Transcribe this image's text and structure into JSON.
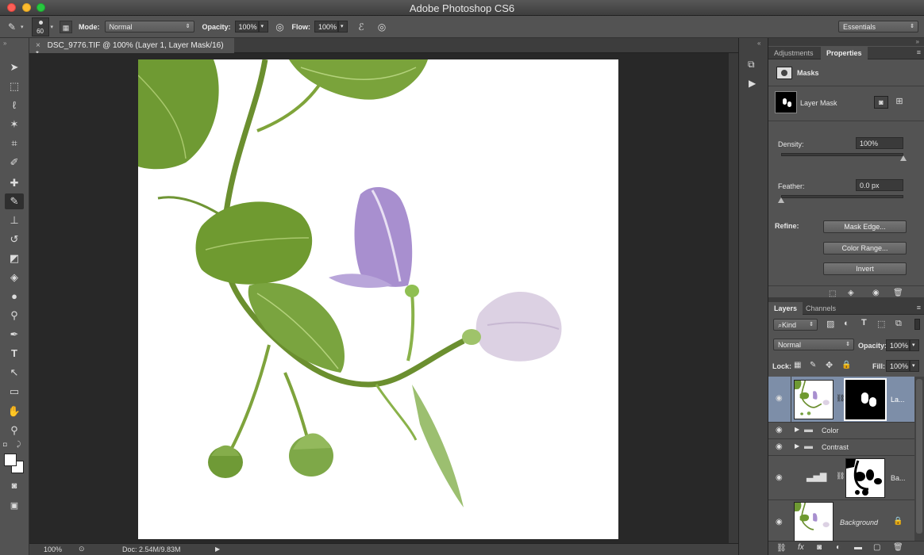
{
  "window": {
    "title": "Adobe Photoshop CS6"
  },
  "options": {
    "brush_size": "60",
    "mode_label": "Mode:",
    "mode_value": "Normal",
    "opacity_label": "Opacity:",
    "opacity_value": "100%",
    "flow_label": "Flow:",
    "flow_value": "100%",
    "workspace": "Essentials"
  },
  "document": {
    "tab_title": "DSC_9776.TIF @ 100% (Layer 1, Layer Mask/16) *",
    "close_glyph": "×"
  },
  "status": {
    "zoom": "100%",
    "doc_info": "Doc: 2.54M/9.83M"
  },
  "properties": {
    "tabs": [
      "Adjustments",
      "Properties"
    ],
    "section": "Masks",
    "mask_name": "Layer Mask",
    "density_label": "Density:",
    "density_value": "100%",
    "density_fraction": 1.0,
    "feather_label": "Feather:",
    "feather_value": "0.0 px",
    "feather_fraction": 0.0,
    "refine_label": "Refine:",
    "buttons": [
      "Mask Edge...",
      "Color Range...",
      "Invert"
    ]
  },
  "layers": {
    "tabs": [
      "Layers",
      "Channels"
    ],
    "filter": "Kind",
    "blend_mode": "Normal",
    "opacity_label": "Opacity:",
    "opacity_value": "100%",
    "lock_label": "Lock:",
    "fill_label": "Fill:",
    "fill_value": "100%",
    "items": [
      {
        "name": "La...",
        "type": "masked"
      },
      {
        "name": "Color",
        "type": "group"
      },
      {
        "name": "Contrast",
        "type": "group"
      },
      {
        "name": "Ba...",
        "type": "adjustment"
      },
      {
        "name": "Background",
        "type": "background"
      }
    ]
  },
  "colors": {
    "selected_layer": "#7d8ea8",
    "panel": "#535353",
    "canvas_bg": "#282828"
  }
}
